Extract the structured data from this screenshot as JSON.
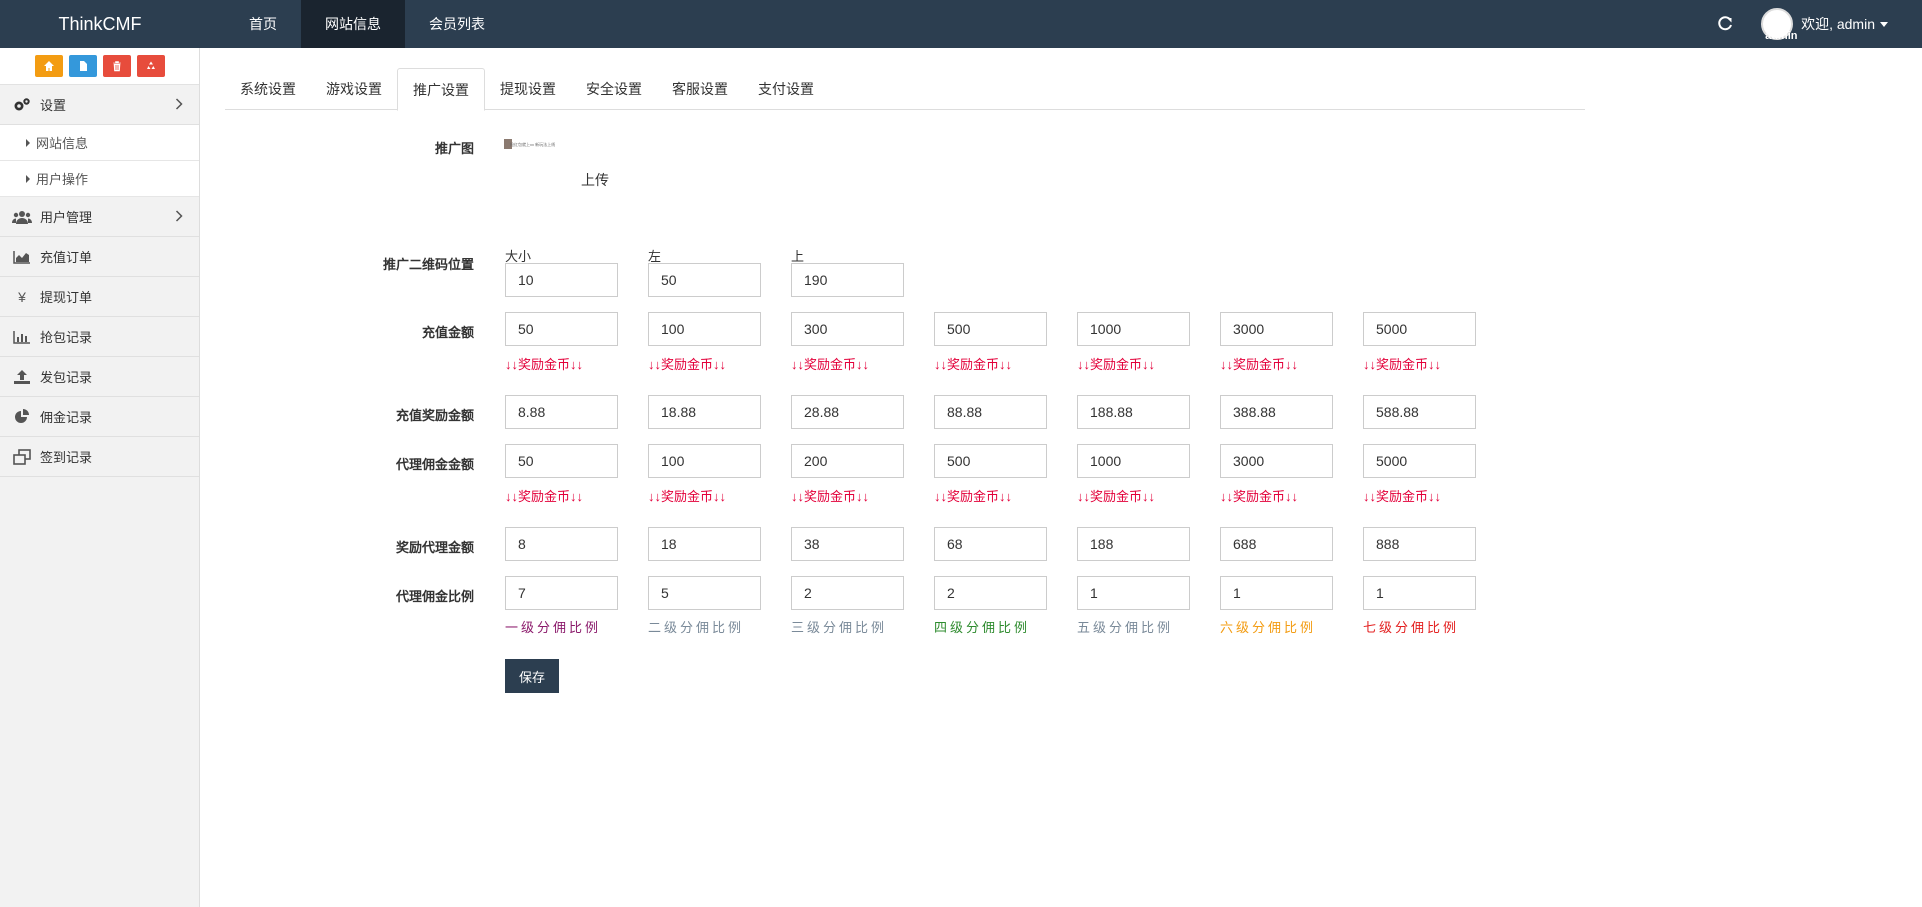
{
  "navbar": {
    "brand": "ThinkCMF",
    "items": [
      {
        "label": "首页",
        "active": false
      },
      {
        "label": "网站信息",
        "active": true
      },
      {
        "label": "会员列表",
        "active": false
      }
    ],
    "avatar_alt": "admin",
    "welcome": "欢迎, admin",
    "bg_color": "#2c3e50"
  },
  "sidebar": {
    "shortcuts": [
      {
        "icon": "home-icon",
        "color": "#f39c12"
      },
      {
        "icon": "file-icon",
        "color": "#3498db"
      },
      {
        "icon": "trash-icon",
        "color": "#e74c3c"
      },
      {
        "icon": "recycle-icon",
        "color": "#e74c3c"
      }
    ],
    "settings": {
      "label": "设置",
      "icon": "gears-icon"
    },
    "settings_sub": [
      {
        "label": "网站信息"
      },
      {
        "label": "用户操作"
      }
    ],
    "menu": [
      {
        "label": "用户管理",
        "icon": "users-icon",
        "has_children": true
      },
      {
        "label": "充值订单",
        "icon": "area-chart-icon",
        "has_children": false
      },
      {
        "label": "提现订单",
        "icon": "yen-icon",
        "has_children": false
      },
      {
        "label": "抢包记录",
        "icon": "bar-chart-icon",
        "has_children": false
      },
      {
        "label": "发包记录",
        "icon": "upload-icon",
        "has_children": false
      },
      {
        "label": "佣金记录",
        "icon": "pie-chart-icon",
        "has_children": false
      },
      {
        "label": "签到记录",
        "icon": "clone-icon",
        "has_children": false
      }
    ]
  },
  "tabs": [
    {
      "label": "系统设置",
      "active": false
    },
    {
      "label": "游戏设置",
      "active": false
    },
    {
      "label": "推广设置",
      "active": true
    },
    {
      "label": "提现设置",
      "active": false
    },
    {
      "label": "安全设置",
      "active": false
    },
    {
      "label": "客服设置",
      "active": false
    },
    {
      "label": "支付设置",
      "active": false
    }
  ],
  "form": {
    "promo_image": {
      "label": "推广图",
      "upload_label": "上传",
      "thumb_text": "抢红包就上xx 新玩法上线"
    },
    "qr_position": {
      "label": "推广二维码位置",
      "fields": [
        {
          "caption": "大小",
          "value": "10"
        },
        {
          "caption": "左",
          "value": "50"
        },
        {
          "caption": "上",
          "value": "190"
        }
      ]
    },
    "recharge_amounts": {
      "label": "充值金额",
      "values": [
        "50",
        "100",
        "300",
        "500",
        "1000",
        "3000",
        "5000"
      ]
    },
    "reward_note": "↓↓奖励金币↓↓",
    "recharge_rewards": {
      "label": "充值奖励金额",
      "values": [
        "8.88",
        "18.88",
        "28.88",
        "88.88",
        "188.88",
        "388.88",
        "588.88"
      ]
    },
    "agent_commission": {
      "label": "代理佣金金额",
      "values": [
        "50",
        "100",
        "200",
        "500",
        "1000",
        "3000",
        "5000"
      ]
    },
    "agent_rewards": {
      "label": "奖励代理金额",
      "values": [
        "8",
        "18",
        "38",
        "68",
        "188",
        "688",
        "888"
      ]
    },
    "commission_ratio": {
      "label": "代理佣金比例",
      "values": [
        "7",
        "5",
        "2",
        "2",
        "1",
        "1",
        "1"
      ],
      "levels": [
        {
          "text": "一级分佣比例",
          "color": "#8b1a6b"
        },
        {
          "text": "二级分佣比例",
          "color": "#7a8a99"
        },
        {
          "text": "三级分佣比例",
          "color": "#7a8a99"
        },
        {
          "text": "四级分佣比例",
          "color": "#2e8b2e"
        },
        {
          "text": "五级分佣比例",
          "color": "#7a8a99"
        },
        {
          "text": "六级分佣比例",
          "color": "#f39c12"
        },
        {
          "text": "七级分佣比例",
          "color": "#e32020"
        }
      ]
    },
    "save_label": "保存"
  }
}
